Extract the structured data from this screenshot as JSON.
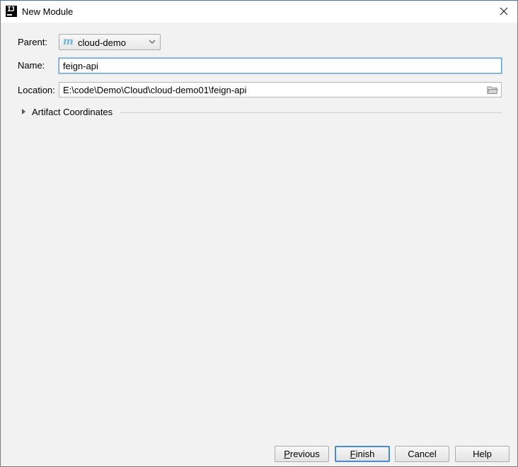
{
  "window": {
    "title": "New Module"
  },
  "form": {
    "parent_label": "Parent:",
    "parent_value": "cloud-demo",
    "name_label": "Name:",
    "name_value": "feign-api",
    "location_label": "Location:",
    "location_value": "E:\\code\\Demo\\Cloud\\cloud-demo01\\feign-api"
  },
  "artifact": {
    "label": "Artifact Coordinates"
  },
  "buttons": {
    "previous_mnemonic": "P",
    "previous_rest": "revious",
    "finish_mnemonic": "F",
    "finish_rest": "inish",
    "cancel": "Cancel",
    "help": "Help"
  },
  "colors": {
    "accent": "#4a8ad1",
    "maven_icon": "#6fb3d6",
    "focus_border": "#6aa5d8"
  },
  "icons": {
    "app": "intellij-icon",
    "parent": "maven-module-icon",
    "browse": "folder-icon",
    "close": "close-icon"
  }
}
